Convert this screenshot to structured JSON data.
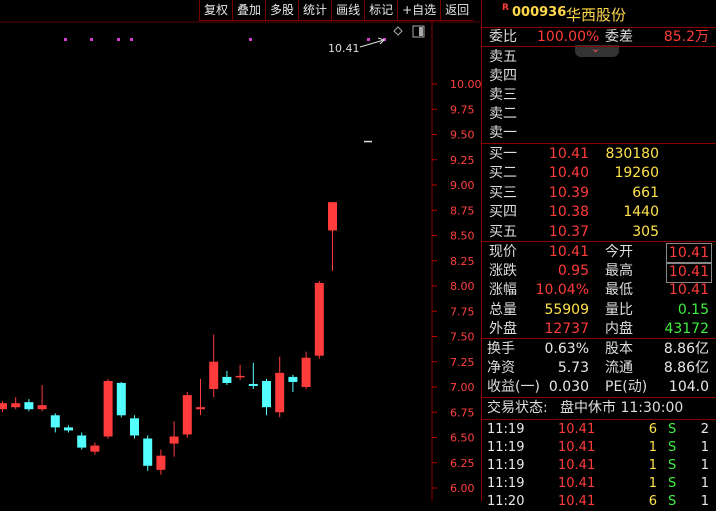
{
  "toolbar": [
    "复权",
    "叠加",
    "多股",
    "统计",
    "画线",
    "标记",
    "+自选",
    "返回"
  ],
  "chart_data": {
    "type": "candlestick",
    "y_ticks": [
      "10.00",
      "9.75",
      "9.50",
      "9.25",
      "9.00",
      "8.75",
      "8.50",
      "8.25",
      "8.00",
      "7.75",
      "7.50",
      "7.25",
      "7.00",
      "6.75",
      "6.50",
      "6.25",
      "6.00"
    ],
    "ylim": [
      6.0,
      10.0
    ],
    "candles": [
      {
        "o": 6.78,
        "c": 6.84,
        "h": 6.86,
        "l": 6.75
      },
      {
        "o": 6.8,
        "c": 6.84,
        "h": 6.9,
        "l": 6.78
      },
      {
        "o": 6.85,
        "c": 6.78,
        "h": 6.88,
        "l": 6.76
      },
      {
        "o": 6.78,
        "c": 6.82,
        "h": 7.02,
        "l": 6.76
      },
      {
        "o": 6.72,
        "c": 6.6,
        "h": 6.74,
        "l": 6.55
      },
      {
        "o": 6.6,
        "c": 6.57,
        "h": 6.62,
        "l": 6.55
      },
      {
        "o": 6.52,
        "c": 6.4,
        "h": 6.55,
        "l": 6.38
      },
      {
        "o": 6.36,
        "c": 6.42,
        "h": 6.45,
        "l": 6.33
      },
      {
        "o": 6.51,
        "c": 7.06,
        "h": 7.08,
        "l": 6.49
      },
      {
        "o": 7.04,
        "c": 6.72,
        "h": 7.05,
        "l": 6.7
      },
      {
        "o": 6.69,
        "c": 6.52,
        "h": 6.72,
        "l": 6.49
      },
      {
        "o": 6.49,
        "c": 6.22,
        "h": 6.52,
        "l": 6.17
      },
      {
        "o": 6.18,
        "c": 6.32,
        "h": 6.38,
        "l": 6.13
      },
      {
        "o": 6.44,
        "c": 6.51,
        "h": 6.66,
        "l": 6.31
      },
      {
        "o": 6.53,
        "c": 6.92,
        "h": 6.95,
        "l": 6.5
      },
      {
        "o": 6.78,
        "c": 6.8,
        "h": 7.08,
        "l": 6.72
      },
      {
        "o": 6.98,
        "c": 7.25,
        "h": 7.52,
        "l": 6.9
      },
      {
        "o": 7.1,
        "c": 7.04,
        "h": 7.16,
        "l": 7.02
      },
      {
        "o": 7.1,
        "c": 7.11,
        "h": 7.22,
        "l": 7.07
      },
      {
        "o": 7.03,
        "c": 7.01,
        "h": 7.24,
        "l": 6.98
      },
      {
        "o": 7.06,
        "c": 6.8,
        "h": 7.08,
        "l": 6.72
      },
      {
        "o": 6.75,
        "c": 7.14,
        "h": 7.3,
        "l": 6.7
      },
      {
        "o": 7.1,
        "c": 7.05,
        "h": 7.12,
        "l": 6.95
      },
      {
        "o": 7.0,
        "c": 7.29,
        "h": 7.35,
        "l": 6.98
      },
      {
        "o": 7.31,
        "c": 8.03,
        "h": 8.05,
        "l": 7.28
      },
      {
        "o": 8.55,
        "c": 8.83,
        "h": 8.81,
        "l": 8.15
      }
    ],
    "high_label": "10.41"
  },
  "stock": {
    "badge": "R",
    "code": "000936",
    "name": "华西股份"
  },
  "weibi": {
    "l1": "委比",
    "v1": "100.00%",
    "l2": "委差",
    "v2": "85.2万"
  },
  "sell_labels": [
    "卖五",
    "卖四",
    "卖三",
    "卖二",
    "卖一"
  ],
  "buy": [
    {
      "label": "买一",
      "price": "10.41",
      "vol": "830180"
    },
    {
      "label": "买二",
      "price": "10.40",
      "vol": "19260"
    },
    {
      "label": "买三",
      "price": "10.39",
      "vol": "661"
    },
    {
      "label": "买四",
      "price": "10.38",
      "vol": "1440"
    },
    {
      "label": "买五",
      "price": "10.37",
      "vol": "305"
    }
  ],
  "quote": [
    {
      "l1": "现价",
      "v1": "10.41",
      "l2": "今开",
      "v2": "10.41"
    },
    {
      "l1": "涨跌",
      "v1": "0.95",
      "l2": "最高",
      "v2": "10.41"
    },
    {
      "l1": "涨幅",
      "v1": "10.04%",
      "l2": "最低",
      "v2": "10.41"
    },
    {
      "l1": "总量",
      "v1": "55909",
      "l2": "量比",
      "v2": "0.15"
    },
    {
      "l1": "外盘",
      "v1": "12737",
      "l2": "内盘",
      "v2": "43172"
    }
  ],
  "fund": [
    {
      "l1": "换手",
      "v1": "0.63%",
      "l2": "股本",
      "v2": "8.86亿"
    },
    {
      "l1": "净资",
      "v1": "5.73",
      "l2": "流通",
      "v2": "8.86亿"
    },
    {
      "l1": "收益(一)",
      "v1": "0.030",
      "l2": "PE(动)",
      "v2": "104.0"
    }
  ],
  "status": {
    "label": "交易状态:",
    "value": "盘中休市 11:30:00"
  },
  "ticks": [
    {
      "time": "11:19",
      "price": "10.41",
      "vol": "6",
      "side": "S",
      "n": "2"
    },
    {
      "time": "11:19",
      "price": "10.41",
      "vol": "1",
      "side": "S",
      "n": "1"
    },
    {
      "time": "11:19",
      "price": "10.41",
      "vol": "1",
      "side": "S",
      "n": "1"
    },
    {
      "time": "11:19",
      "price": "10.41",
      "vol": "1",
      "side": "S",
      "n": "1"
    },
    {
      "time": "11:20",
      "price": "10.41",
      "vol": "6",
      "side": "S",
      "n": "1"
    }
  ]
}
